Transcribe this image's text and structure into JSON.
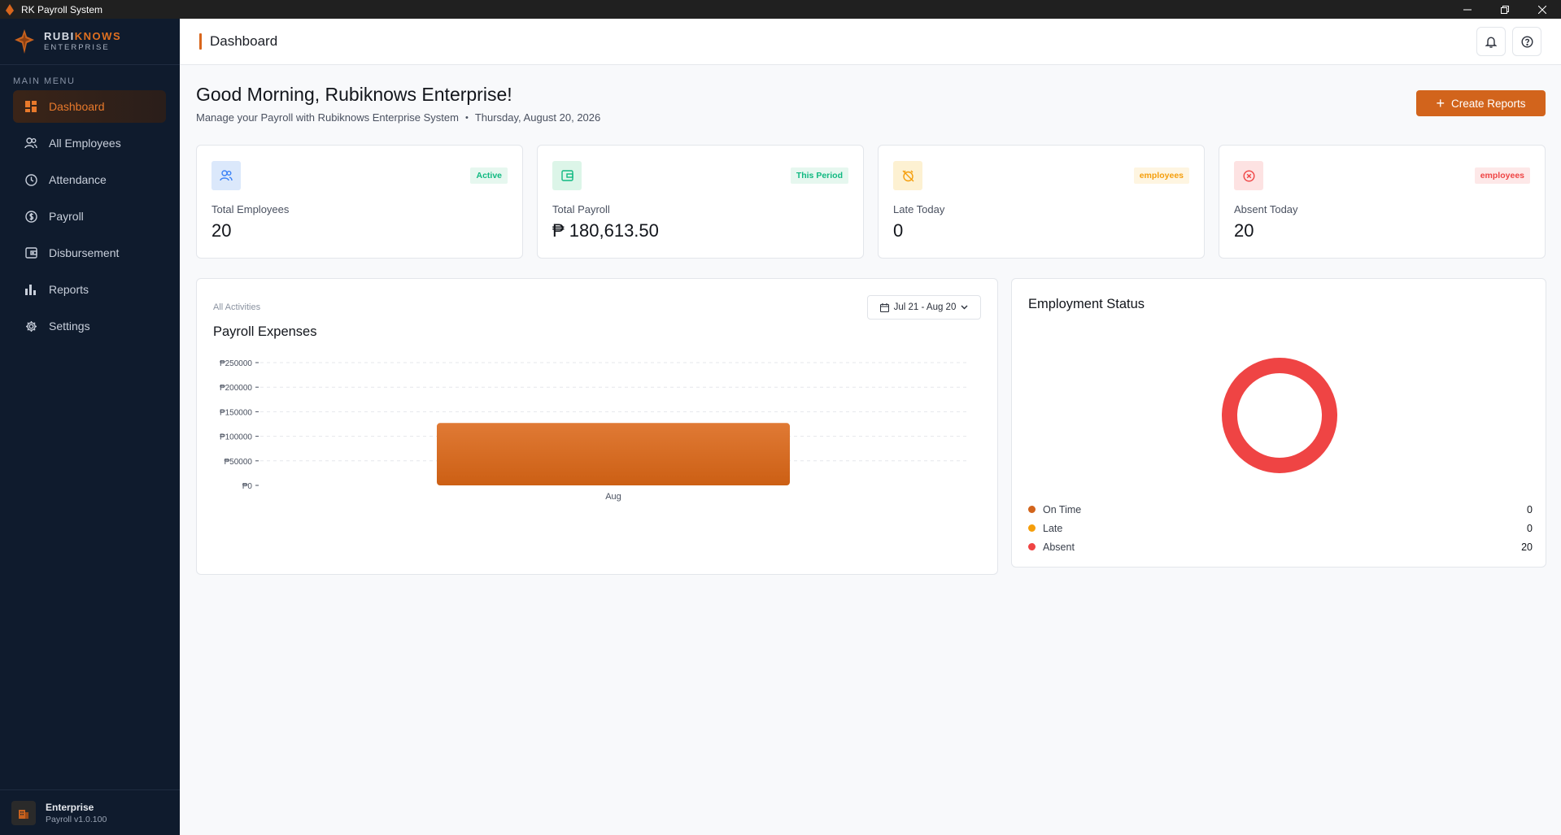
{
  "window": {
    "title": "RK Payroll System"
  },
  "brand": {
    "name_a": "RUBI",
    "name_b": "KNOWS",
    "sub": "ENTERPRISE"
  },
  "sidebar": {
    "heading": "MAIN MENU",
    "items": [
      {
        "label": "Dashboard",
        "icon": "dashboard-icon",
        "active": true
      },
      {
        "label": "All Employees",
        "icon": "users-icon"
      },
      {
        "label": "Attendance",
        "icon": "clock-icon"
      },
      {
        "label": "Payroll",
        "icon": "dollar-icon"
      },
      {
        "label": "Disbursement",
        "icon": "wallet-icon"
      },
      {
        "label": "Reports",
        "icon": "bar-chart-icon"
      },
      {
        "label": "Settings",
        "icon": "gear-icon"
      }
    ],
    "footer": {
      "title": "Enterprise",
      "version": "Payroll v1.0.100"
    }
  },
  "header": {
    "title": "Dashboard"
  },
  "main": {
    "greeting": "Good Morning, Rubiknows Enterprise!",
    "subtitle": "Manage your Payroll with Rubiknows Enterprise System",
    "date": "Thursday, August 20, 2026",
    "create_button": "Create Reports"
  },
  "cards": [
    {
      "label": "Total Employees",
      "value": "20",
      "badge": "Active",
      "icon": "users-icon",
      "badge_color": "#10b981"
    },
    {
      "label": "Total Payroll",
      "value": "₱ 180,613.50",
      "badge": "This Period",
      "icon": "wallet-icon",
      "badge_color": "#10b981"
    },
    {
      "label": "Late Today",
      "value": "0",
      "badge": "employees",
      "icon": "alarm-off-icon",
      "badge_color": "#f59e0b"
    },
    {
      "label": "Absent Today",
      "value": "20",
      "badge": "employees",
      "icon": "x-circle-icon",
      "badge_color": "#ef4444"
    }
  ],
  "payroll_chart": {
    "caption": "All Activities",
    "title": "Payroll Expenses",
    "date_range": "Jul 21 - Aug 20"
  },
  "status": {
    "title": "Employment Status",
    "legend": [
      {
        "label": "On Time",
        "value": "0",
        "color": "#d2641c"
      },
      {
        "label": "Late",
        "value": "0",
        "color": "#f59e0b"
      },
      {
        "label": "Absent",
        "value": "20",
        "color": "#ef4444"
      }
    ]
  },
  "chart_data": [
    {
      "type": "bar",
      "title": "Payroll Expenses",
      "categories": [
        "Aug"
      ],
      "values": [
        127000
      ],
      "ylim": [
        0,
        250000
      ],
      "yticks": [
        "₱0",
        "₱50000",
        "₱100000",
        "₱150000",
        "₱200000",
        "₱250000"
      ],
      "ytick_values": [
        0,
        50000,
        100000,
        150000,
        200000,
        250000
      ],
      "grid": true,
      "color": "#d9661c"
    },
    {
      "type": "pie",
      "title": "Employment Status",
      "categories": [
        "On Time",
        "Late",
        "Absent"
      ],
      "values": [
        0,
        0,
        20
      ],
      "colors": [
        "#d2641c",
        "#f59e0b",
        "#ef4444"
      ]
    }
  ]
}
